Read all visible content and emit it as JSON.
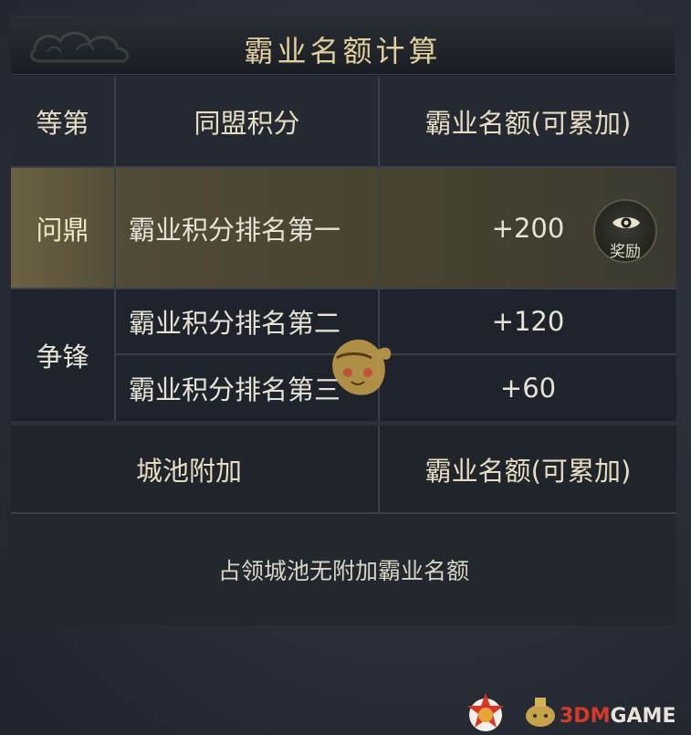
{
  "title": "霸业名额计算",
  "table": {
    "headers": {
      "rank": "等第",
      "alliance_points": "同盟积分",
      "quota": "霸业名额(可累加)"
    },
    "groups": [
      {
        "rank": "问鼎",
        "rows": [
          {
            "condition": "霸业积分排名第一",
            "quota": "+200"
          }
        ]
      },
      {
        "rank": "争锋",
        "rows": [
          {
            "condition": "霸业积分排名第二",
            "quota": "+120"
          },
          {
            "condition": "霸业积分排名第三",
            "quota": "+60"
          }
        ]
      }
    ]
  },
  "city_section": {
    "header_left": "城池附加",
    "header_right": "霸业名额(可累加)",
    "note": "占领城池无附加霸业名额"
  },
  "reward_button": {
    "label": "奖励",
    "icon": "eye-icon"
  },
  "watermark": {
    "brand_prefix": "3DM",
    "brand_suffix": "GAME"
  },
  "colors": {
    "title_gold": "#e2cf9b",
    "highlight_row": "#4f4a38",
    "panel_bg": "#1c2027",
    "divider": "#3b4049"
  }
}
